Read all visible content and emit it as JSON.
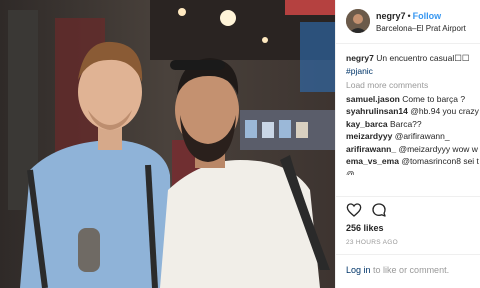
{
  "post": {
    "username": "negry7",
    "follow_label": "Follow",
    "location": "Barcelona–El Prat Airport",
    "caption_user": "negry7",
    "caption_text": "Un encuentro casual☐☐",
    "caption_hashtag": "#pjanic",
    "load_more": "Load more comments",
    "likes": "256 likes",
    "time": "23 HOURS AGO",
    "login_link": "Log in",
    "login_rest": "to like or comment."
  },
  "comments": [
    {
      "user": "samuel.jason",
      "text": "Come to barça ?"
    },
    {
      "user": "syahrulinsan14",
      "text": "@hb.94 you crazy"
    },
    {
      "user": "kay_barca",
      "text": "Barca??"
    },
    {
      "user": "meizardyyy",
      "text": "@arifirawann_"
    },
    {
      "user": "arifirawann_",
      "text": "@meizardyyy wow w"
    },
    {
      "user": "ema_vs_ema",
      "text": "@tomasrincon8 sei t"
    },
    {
      "user": "",
      "text": "@..."
    }
  ],
  "icons": {
    "heart": "heart-outline-icon",
    "comment": "comment-bubble-icon"
  },
  "colors": {
    "link_blue": "#3897f0",
    "muted": "#999999",
    "hashtag": "#003569"
  }
}
